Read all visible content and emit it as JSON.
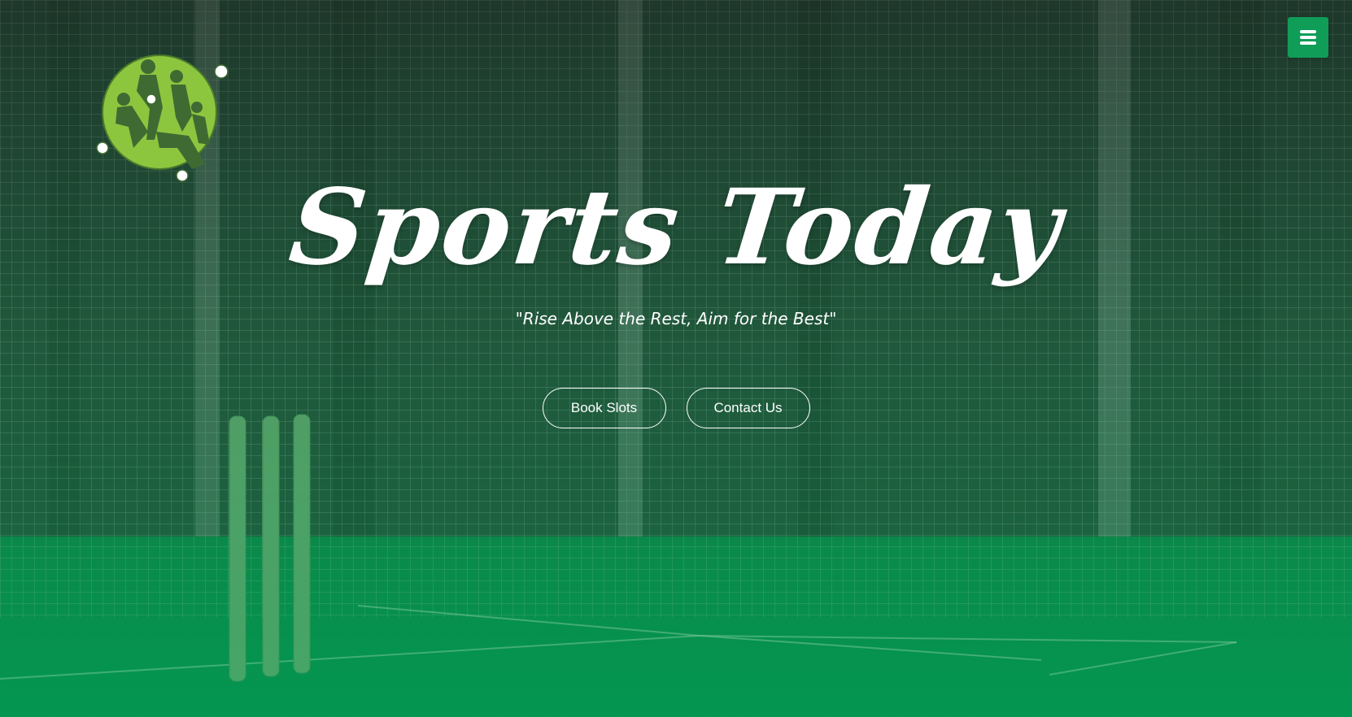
{
  "hero": {
    "title": "Sports Today",
    "tagline": "\"Rise Above the Rest, Aim for the Best\"",
    "buttons": {
      "book_label": "Book Slots",
      "contact_label": "Contact Us"
    }
  },
  "header": {
    "menu_icon": "hamburger-menu-icon",
    "logo_icon": "sports-athletes-logo"
  },
  "colors": {
    "accent": "#0f9d58",
    "logo_green": "#8cc63f",
    "text": "#ffffff"
  }
}
